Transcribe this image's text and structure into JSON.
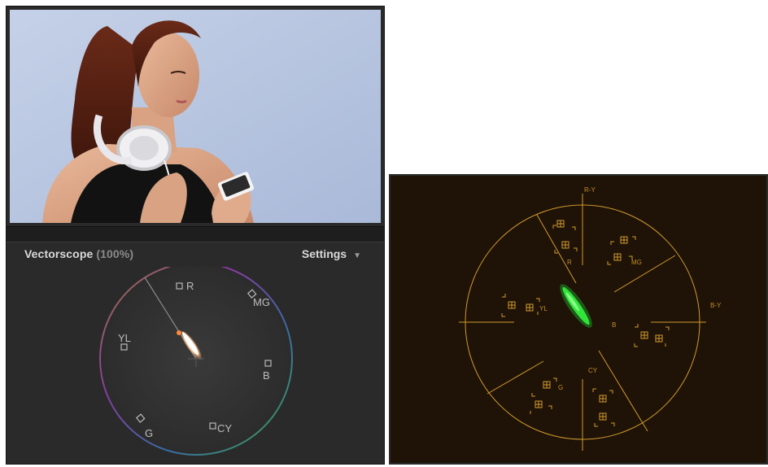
{
  "left_scope": {
    "title": "Vectorscope",
    "zoom_label": "(100%)",
    "settings_label": "Settings",
    "settings_caret": "▼",
    "targets": {
      "r": "R",
      "mg": "MG",
      "b": "B",
      "cy": "CY",
      "g": "G",
      "yl": "YL"
    }
  },
  "right_scope": {
    "labels": {
      "r_y": "R-Y",
      "b_y": "B-Y",
      "r": "R",
      "mg": "MG",
      "yl": "YL",
      "b": "B",
      "cy": "CY",
      "g": "G"
    }
  },
  "colors": {
    "panel_bg": "#2a2a2a",
    "scope_graticule_orange": "#d39a2e",
    "trace_green": "#31e43a",
    "right_bg": "#1e1306"
  }
}
